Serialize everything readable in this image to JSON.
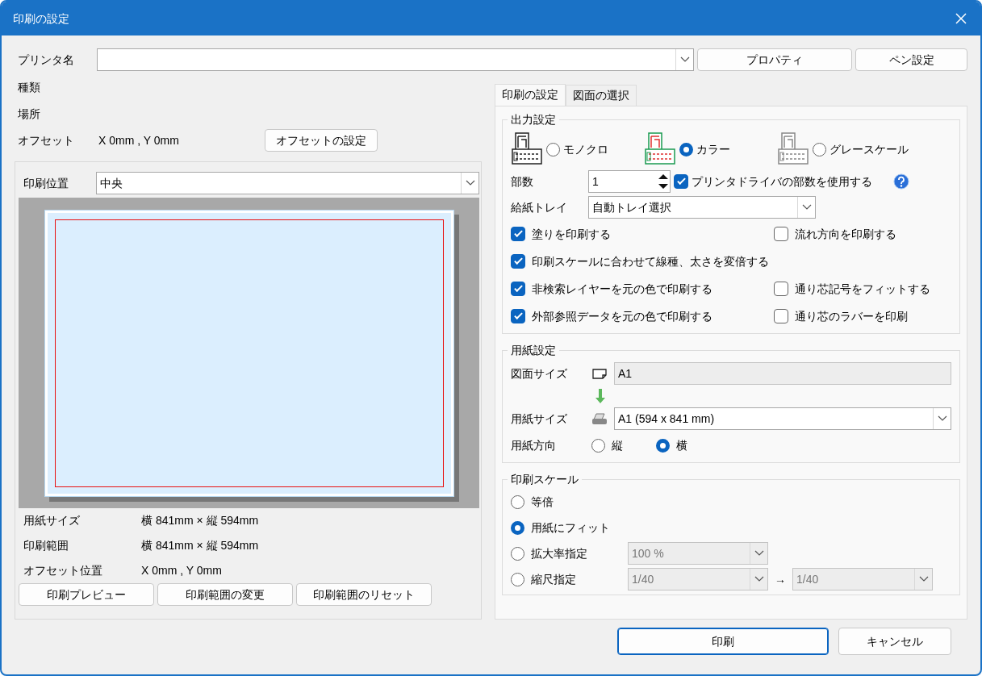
{
  "window": {
    "title": "印刷の設定"
  },
  "printer": {
    "label": "プリンタ名",
    "buttons": [
      "プロパティ",
      "ペン設定"
    ]
  },
  "info": [
    {
      "label": "種類"
    },
    {
      "label": "場所"
    }
  ],
  "offset": {
    "label": "オフセット",
    "value": "X 0mm , Y 0mm",
    "button": "オフセットの設定"
  },
  "preview_panel": {
    "position_label": "印刷位置",
    "position_value": "中央",
    "details": [
      {
        "label": "用紙サイズ",
        "value": "横 841mm × 縦 594mm"
      },
      {
        "label": "印刷範囲",
        "value": "横 841mm × 縦 594mm"
      },
      {
        "label": "オフセット位置",
        "value": "X 0mm , Y 0mm"
      }
    ],
    "buttons": [
      "印刷プレビュー",
      "印刷範囲の変更",
      "印刷範囲のリセット"
    ]
  },
  "tabs": [
    {
      "label": "印刷の設定",
      "selected": true
    },
    {
      "label": "図面の選択",
      "selected": false
    }
  ],
  "output": {
    "title": "出力設定",
    "modes": [
      {
        "label": "モノクロ",
        "selected": false,
        "kind": "mono"
      },
      {
        "label": "カラー",
        "selected": true,
        "kind": "color"
      },
      {
        "label": "グレースケール",
        "selected": false,
        "kind": "gray"
      }
    ],
    "copies": {
      "label": "部数",
      "value": "1"
    },
    "use_driver": {
      "label": "プリンタドライバの部数を使用する",
      "checked": true
    },
    "tray": {
      "label": "給紙トレイ",
      "value": "自動トレイ選択"
    },
    "option_rows": [
      [
        {
          "label": "塗りを印刷する",
          "checked": true
        },
        {
          "label": "流れ方向を印刷する",
          "checked": false
        }
      ],
      [
        {
          "label": "印刷スケールに合わせて線種、太さを変倍する",
          "checked": true
        }
      ],
      [
        {
          "label": "非検索レイヤーを元の色で印刷する",
          "checked": true
        },
        {
          "label": "通り芯記号をフィットする",
          "checked": false
        }
      ],
      [
        {
          "label": "外部参照データを元の色で印刷する",
          "checked": true
        },
        {
          "label": "通り芯のラバーを印刷",
          "checked": false
        }
      ]
    ]
  },
  "paper": {
    "title": "用紙設定",
    "drawing_size": {
      "label": "図面サイズ",
      "value": "A1"
    },
    "paper_size": {
      "label": "用紙サイズ",
      "value": "A1 (594 x 841 mm)"
    },
    "orientation": {
      "label": "用紙方向",
      "options": [
        {
          "label": "縦",
          "selected": false
        },
        {
          "label": "横",
          "selected": true
        }
      ]
    }
  },
  "scale": {
    "title": "印刷スケール",
    "options": [
      {
        "kind": "plain",
        "label": "等倍",
        "selected": false
      },
      {
        "kind": "plain",
        "label": "用紙にフィット",
        "selected": true
      },
      {
        "kind": "field",
        "label": "拡大率指定",
        "selected": false,
        "fields": [
          "100 %"
        ]
      },
      {
        "kind": "pair",
        "label": "縮尺指定",
        "selected": false,
        "fields": [
          "1/40",
          "1/40"
        ],
        "arrow": "→"
      }
    ]
  },
  "footer": {
    "buttons": [
      "印刷",
      "キャンセル"
    ]
  }
}
